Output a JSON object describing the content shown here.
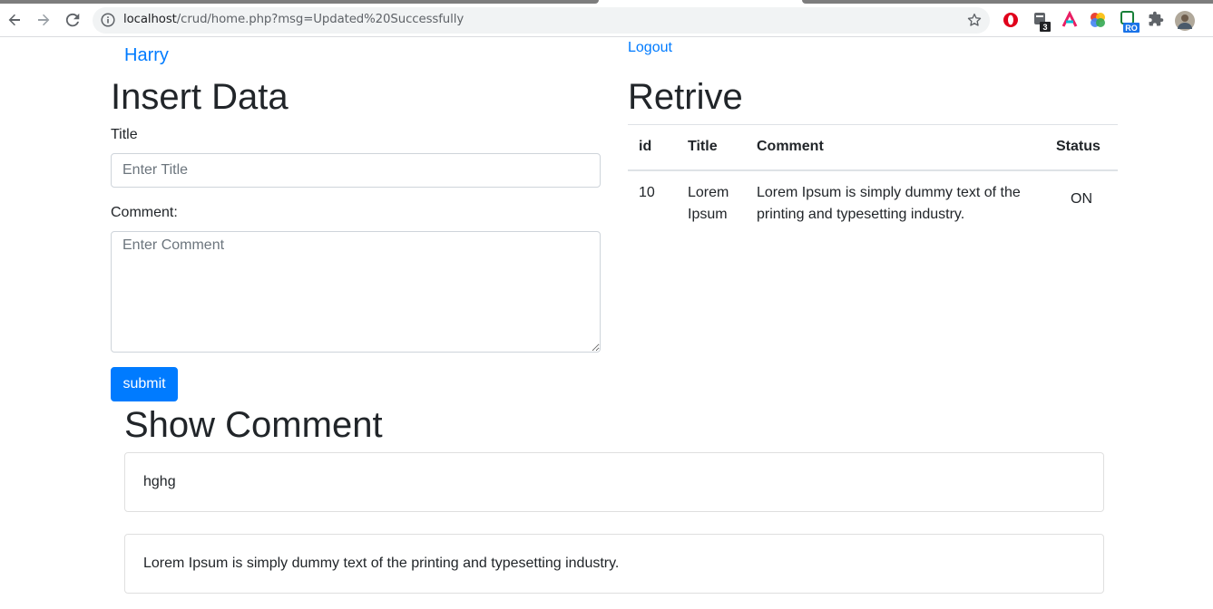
{
  "browser": {
    "url_host": "localhost",
    "url_rest": "/crud/home.php?msg=Updated%20Successfully",
    "icons": [
      "back-icon",
      "forward-icon",
      "reload-icon",
      "info-icon",
      "bookmark-star-icon",
      "opera-icon",
      "extension-badge-icon",
      "arc-icon",
      "color-wheel-icon",
      "ro-extension-icon",
      "puzzle-icon",
      "profile-avatar-icon"
    ],
    "extension_badge": "3",
    "ro_badge": "RO"
  },
  "header": {
    "user_name": "Harry",
    "logout": "Logout"
  },
  "insert": {
    "heading": "Insert Data",
    "title_label": "Title",
    "title_placeholder": "Enter Title",
    "comment_label": "Comment:",
    "comment_placeholder": "Enter Comment",
    "submit": "submit"
  },
  "retrive": {
    "heading": "Retrive",
    "columns": [
      "id",
      "Title",
      "Comment",
      "Status"
    ],
    "rows": [
      {
        "id": "10",
        "title": "Lorem Ipsum",
        "comment": "Lorem Ipsum is simply dummy text of the printing and typesetting industry.",
        "status": "ON"
      }
    ]
  },
  "show": {
    "heading": "Show Comment",
    "comments": [
      "hghg",
      "Lorem Ipsum is simply dummy text of the printing and typesetting industry."
    ]
  },
  "colors": {
    "primary": "#007bff",
    "text": "#212529"
  }
}
